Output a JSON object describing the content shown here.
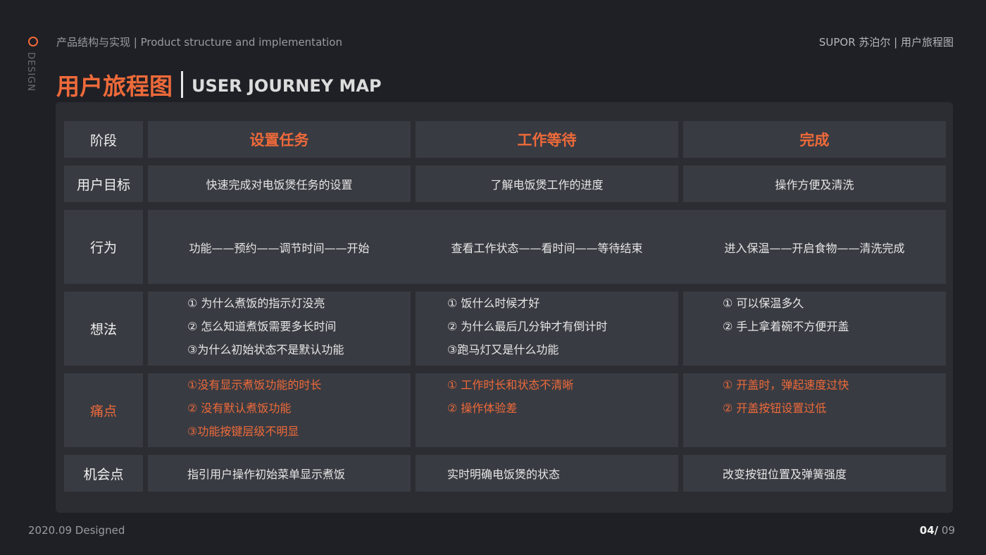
{
  "side": {
    "label": "DESIGN"
  },
  "header": {
    "left": "产品结构与实现 | Product structure and implementation",
    "right": "SUPOR 苏泊尔 | 用户旅程图"
  },
  "title": {
    "cn": "用户旅程图",
    "en": "USER JOURNEY MAP"
  },
  "table": {
    "row_labels": {
      "stage": "阶段",
      "goal": "用户目标",
      "behavior": "行为",
      "thoughts": "想法",
      "pain": "痛点",
      "opportunity": "机会点"
    },
    "stages": [
      "设置任务",
      "工作等待",
      "完成"
    ],
    "goals": [
      "快速完成对电饭煲任务的设置",
      "了解电饭煲工作的进度",
      "操作方便及清洗"
    ],
    "behaviors": [
      "功能——预约——调节时间——开始",
      "查看工作状态——看时间——等待结束",
      "进入保温——开启食物——清洗完成"
    ],
    "thoughts": [
      [
        "① 为什么煮饭的指示灯没亮",
        "② 怎么知道煮饭需要多长时间",
        "③为什么初始状态不是默认功能"
      ],
      [
        "① 饭什么时候才好",
        "② 为什么最后几分钟才有倒计时",
        "③跑马灯又是什么功能"
      ],
      [
        "① 可以保温多久",
        "② 手上拿着碗不方便开盖",
        ""
      ]
    ],
    "pains": [
      [
        "①没有显示煮饭功能的时长",
        "② 没有默认煮饭功能",
        "③功能按键层级不明显"
      ],
      [
        "① 工作时长和状态不清晰",
        "② 操作体验差",
        ""
      ],
      [
        "① 开盖时，弹起速度过快",
        "② 开盖按钮设置过低",
        ""
      ]
    ],
    "opportunities": [
      "指引用户操作初始菜单显示煮饭",
      "实时明确电饭煲的状态",
      "改变按钮位置及弹簧强度"
    ]
  },
  "footer": {
    "left": "2020.09  Designed",
    "page_current": "04/",
    "page_total": " 09"
  },
  "colors": {
    "accent": "#ee6a3a",
    "background": "#1f2025",
    "panel": "#2c2d33",
    "cell": "#393b42"
  }
}
